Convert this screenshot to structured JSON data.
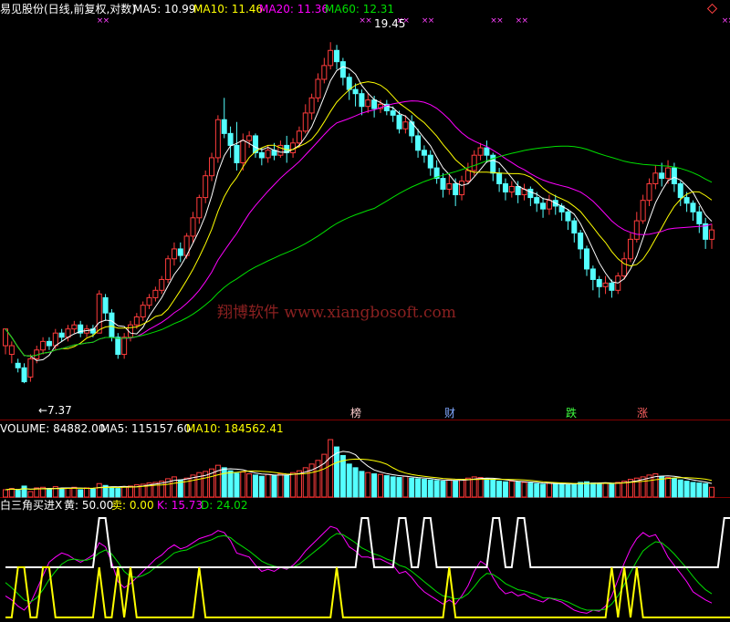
{
  "colors": {
    "background": "#000000",
    "up": "#ff3c3c",
    "down": "#54ffff",
    "ma5": "#ffffff",
    "ma10": "#ffff00",
    "ma20": "#ff00ff",
    "ma60": "#00e000",
    "separator": "#800000",
    "watermark": "#8a2020"
  },
  "header": {
    "title": "易见股份(日线,前复权,对数)",
    "ma5_label": "MA5: 10.99",
    "ma10_label": "MA10: 11.46",
    "ma20_label": "MA20: 11.36",
    "ma60_label": "MA60: 12.31",
    "corner_icon": "diamond-icon"
  },
  "annotations": {
    "high_label": "19.45",
    "low_label": "←7.37",
    "markers": [
      "榜",
      "财",
      "跌",
      "涨"
    ]
  },
  "watermark": "翔博软件 www.xiangbosoft.com",
  "volume_header": {
    "label": "VOLUME: 84882.00",
    "ma5": "MA5: 115157.60",
    "ma10": "MA10: 184562.41"
  },
  "indicator_header": {
    "name": "白三角买进X",
    "huang": "黄: 50.00",
    "mai": "卖: 0.00",
    "k": "K: 15.73",
    "d": "D: 24.02"
  },
  "chart_data": {
    "type": "candlestick",
    "price_range": [
      7.0,
      20.5
    ],
    "price_scale": "log",
    "high": 19.45,
    "low": 7.37,
    "candles": [
      [
        8.2,
        8.6,
        8.4,
        8.0
      ],
      [
        8.0,
        8.2,
        8.3,
        7.8
      ],
      [
        7.8,
        7.7,
        7.9,
        7.6
      ],
      [
        7.7,
        7.4,
        7.8,
        7.37
      ],
      [
        7.5,
        7.9,
        8.0,
        7.4
      ],
      [
        7.9,
        8.1,
        8.2,
        7.8
      ],
      [
        8.1,
        8.3,
        8.4,
        8.0
      ],
      [
        8.3,
        8.2,
        8.4,
        8.1
      ],
      [
        8.2,
        8.5,
        8.6,
        8.1
      ],
      [
        8.5,
        8.4,
        8.6,
        8.3
      ],
      [
        8.4,
        8.6,
        8.7,
        8.3
      ],
      [
        8.6,
        8.7,
        8.8,
        8.5
      ],
      [
        8.7,
        8.5,
        8.8,
        8.4
      ],
      [
        8.5,
        8.6,
        8.7,
        8.4
      ],
      [
        8.6,
        8.5,
        8.7,
        8.4
      ],
      [
        8.5,
        9.5,
        9.6,
        8.5
      ],
      [
        9.4,
        9.0,
        9.5,
        8.8
      ],
      [
        9.0,
        8.4,
        9.1,
        8.3
      ],
      [
        8.4,
        8.0,
        8.5,
        7.9
      ],
      [
        8.0,
        8.4,
        8.5,
        7.9
      ],
      [
        8.4,
        8.7,
        8.8,
        8.3
      ],
      [
        8.7,
        8.9,
        9.0,
        8.6
      ],
      [
        8.9,
        9.2,
        9.3,
        8.8
      ],
      [
        9.2,
        9.4,
        9.5,
        9.1
      ],
      [
        9.4,
        9.6,
        9.7,
        9.3
      ],
      [
        9.6,
        9.9,
        10.0,
        9.5
      ],
      [
        9.9,
        10.5,
        10.6,
        9.8
      ],
      [
        10.5,
        10.8,
        11.0,
        10.3
      ],
      [
        10.8,
        10.6,
        11.0,
        10.4
      ],
      [
        10.6,
        11.2,
        11.3,
        10.5
      ],
      [
        11.2,
        11.8,
        12.0,
        11.0
      ],
      [
        11.8,
        12.5,
        12.6,
        11.6
      ],
      [
        12.5,
        13.3,
        13.5,
        12.3
      ],
      [
        13.3,
        14.0,
        14.2,
        13.1
      ],
      [
        14.0,
        15.6,
        15.8,
        13.8
      ],
      [
        15.6,
        15.0,
        16.6,
        14.8
      ],
      [
        15.0,
        14.5,
        15.3,
        14.0
      ],
      [
        14.5,
        13.8,
        15.5,
        13.5
      ],
      [
        13.8,
        14.7,
        15.0,
        13.5
      ],
      [
        14.7,
        14.9,
        15.1,
        14.4
      ],
      [
        14.9,
        14.2,
        15.0,
        14.0
      ],
      [
        14.2,
        14.0,
        14.4,
        13.7
      ],
      [
        14.0,
        14.3,
        14.5,
        13.8
      ],
      [
        14.3,
        14.1,
        14.6,
        13.9
      ],
      [
        14.1,
        14.5,
        14.7,
        14.0
      ],
      [
        14.5,
        14.2,
        14.9,
        13.8
      ],
      [
        14.2,
        14.6,
        14.8,
        14.0
      ],
      [
        14.6,
        15.1,
        15.3,
        14.4
      ],
      [
        15.1,
        15.9,
        16.3,
        15.0
      ],
      [
        15.9,
        16.6,
        16.8,
        15.6
      ],
      [
        16.6,
        17.5,
        17.8,
        16.4
      ],
      [
        17.5,
        18.2,
        18.6,
        17.3
      ],
      [
        18.2,
        19.0,
        19.45,
        18.0
      ],
      [
        19.0,
        18.4,
        19.3,
        18.0
      ],
      [
        18.4,
        17.6,
        18.6,
        17.2
      ],
      [
        17.6,
        17.0,
        17.8,
        16.5
      ],
      [
        17.0,
        16.8,
        17.3,
        16.2
      ],
      [
        16.8,
        16.2,
        17.0,
        15.8
      ],
      [
        16.2,
        16.5,
        16.8,
        15.9
      ],
      [
        16.5,
        16.1,
        16.7,
        15.7
      ],
      [
        16.1,
        16.3,
        16.5,
        15.9
      ],
      [
        16.3,
        16.0,
        16.5,
        15.8
      ],
      [
        16.0,
        15.8,
        16.2,
        15.5
      ],
      [
        15.8,
        15.2,
        16.0,
        15.0
      ],
      [
        15.2,
        15.5,
        15.8,
        15.0
      ],
      [
        15.5,
        14.9,
        15.8,
        14.6
      ],
      [
        14.9,
        14.3,
        15.2,
        14.0
      ],
      [
        14.3,
        14.1,
        14.5,
        13.8
      ],
      [
        14.1,
        13.6,
        14.3,
        13.3
      ],
      [
        13.6,
        13.2,
        13.9,
        13.0
      ],
      [
        13.2,
        12.8,
        13.4,
        12.5
      ],
      [
        12.8,
        13.0,
        13.3,
        12.6
      ],
      [
        13.0,
        12.6,
        13.2,
        12.2
      ],
      [
        12.6,
        13.1,
        13.3,
        12.4
      ],
      [
        13.1,
        13.5,
        13.8,
        13.0
      ],
      [
        13.5,
        14.1,
        14.3,
        13.3
      ],
      [
        14.1,
        14.4,
        14.6,
        13.9
      ],
      [
        14.4,
        14.1,
        14.7,
        13.8
      ],
      [
        14.1,
        13.4,
        14.2,
        13.1
      ],
      [
        13.4,
        13.0,
        13.6,
        12.7
      ],
      [
        13.0,
        12.7,
        13.2,
        12.4
      ],
      [
        12.7,
        12.9,
        13.1,
        12.5
      ],
      [
        12.9,
        12.6,
        13.1,
        12.3
      ],
      [
        12.6,
        12.8,
        13.0,
        12.4
      ],
      [
        12.8,
        12.5,
        12.9,
        12.2
      ],
      [
        12.5,
        12.3,
        12.7,
        12.0
      ],
      [
        12.3,
        12.1,
        12.5,
        11.8
      ],
      [
        12.1,
        12.4,
        12.6,
        11.9
      ],
      [
        12.4,
        12.2,
        12.6,
        11.9
      ],
      [
        12.2,
        12.0,
        12.3,
        11.7
      ],
      [
        12.0,
        11.7,
        12.1,
        11.4
      ],
      [
        11.7,
        11.3,
        11.8,
        11.0
      ],
      [
        11.3,
        10.8,
        11.4,
        10.5
      ],
      [
        10.8,
        10.2,
        10.9,
        10.0
      ],
      [
        10.2,
        9.9,
        10.3,
        9.6
      ],
      [
        9.9,
        9.7,
        10.0,
        9.4
      ],
      [
        9.7,
        9.8,
        10.0,
        9.5
      ],
      [
        9.8,
        9.6,
        9.9,
        9.4
      ],
      [
        9.6,
        10.0,
        10.1,
        9.5
      ],
      [
        10.0,
        10.5,
        10.7,
        9.9
      ],
      [
        10.5,
        11.1,
        11.3,
        10.4
      ],
      [
        11.1,
        11.7,
        12.0,
        11.0
      ],
      [
        11.7,
        12.4,
        12.6,
        11.6
      ],
      [
        12.4,
        13.0,
        13.2,
        12.2
      ],
      [
        13.0,
        13.4,
        13.7,
        12.8
      ],
      [
        13.4,
        13.2,
        13.8,
        12.9
      ],
      [
        13.2,
        13.6,
        13.9,
        13.0
      ],
      [
        13.6,
        13.0,
        13.8,
        12.7
      ],
      [
        13.0,
        12.5,
        13.1,
        12.2
      ],
      [
        12.5,
        12.3,
        12.7,
        12.0
      ],
      [
        12.3,
        12.0,
        12.4,
        11.7
      ],
      [
        12.0,
        11.6,
        12.2,
        11.3
      ],
      [
        11.6,
        11.1,
        11.8,
        10.8
      ],
      [
        11.1,
        11.4,
        11.6,
        10.8
      ]
    ],
    "volume_range": [
      0,
      1000000
    ],
    "volume": [
      120000,
      140000,
      110000,
      180000,
      90000,
      150000,
      160000,
      130000,
      170000,
      140000,
      150000,
      160000,
      120000,
      150000,
      130000,
      220000,
      190000,
      160000,
      140000,
      170000,
      180000,
      200000,
      210000,
      230000,
      240000,
      260000,
      300000,
      330000,
      280000,
      310000,
      360000,
      400000,
      420000,
      460000,
      520000,
      480000,
      430000,
      390000,
      410000,
      380000,
      360000,
      340000,
      370000,
      350000,
      380000,
      360000,
      400000,
      430000,
      480000,
      540000,
      600000,
      700000,
      940000,
      820000,
      680000,
      540000,
      480000,
      420000,
      400000,
      380000,
      370000,
      350000,
      330000,
      320000,
      340000,
      310000,
      300000,
      290000,
      280000,
      270000,
      260000,
      280000,
      270000,
      290000,
      310000,
      330000,
      320000,
      300000,
      280000,
      260000,
      250000,
      260000,
      250000,
      240000,
      230000,
      220000,
      210000,
      230000,
      220000,
      210000,
      200000,
      220000,
      240000,
      250000,
      230000,
      220000,
      230000,
      220000,
      240000,
      260000,
      290000,
      310000,
      330000,
      360000,
      380000,
      340000,
      320000,
      300000,
      280000,
      260000,
      240000,
      230000,
      220000,
      160000
    ],
    "indicator_range": [
      0,
      100
    ],
    "indicator": {
      "k": [
        22,
        18,
        12,
        8,
        15,
        28,
        42,
        55,
        60,
        64,
        62,
        58,
        55,
        58,
        62,
        74,
        70,
        55,
        36,
        30,
        34,
        40,
        46,
        52,
        58,
        62,
        68,
        72,
        68,
        70,
        74,
        78,
        80,
        82,
        86,
        84,
        76,
        64,
        62,
        60,
        52,
        46,
        48,
        46,
        50,
        48,
        52,
        58,
        66,
        72,
        78,
        84,
        90,
        88,
        80,
        70,
        66,
        60,
        60,
        58,
        58,
        55,
        52,
        44,
        46,
        40,
        32,
        26,
        22,
        18,
        14,
        18,
        14,
        22,
        32,
        46,
        56,
        52,
        40,
        30,
        24,
        26,
        22,
        24,
        20,
        18,
        16,
        20,
        18,
        16,
        12,
        8,
        6,
        5,
        8,
        7,
        12,
        22,
        38,
        54,
        68,
        78,
        84,
        80,
        82,
        72,
        60,
        52,
        44,
        36,
        26,
        22,
        18,
        15
      ],
      "d": [
        35,
        30,
        24,
        18,
        16,
        20,
        28,
        38,
        46,
        53,
        57,
        58,
        57,
        57,
        59,
        64,
        67,
        63,
        55,
        46,
        41,
        40,
        42,
        45,
        50,
        54,
        59,
        64,
        66,
        67,
        70,
        73,
        75,
        77,
        80,
        81,
        79,
        74,
        70,
        66,
        61,
        56,
        53,
        51,
        50,
        49,
        50,
        53,
        58,
        63,
        68,
        73,
        79,
        83,
        82,
        78,
        74,
        69,
        66,
        63,
        61,
        58,
        56,
        52,
        50,
        46,
        41,
        36,
        31,
        26,
        22,
        21,
        19,
        20,
        24,
        31,
        39,
        44,
        43,
        39,
        34,
        31,
        28,
        27,
        25,
        23,
        20,
        20,
        19,
        18,
        16,
        13,
        10,
        8,
        8,
        8,
        9,
        14,
        22,
        33,
        45,
        56,
        66,
        71,
        75,
        74,
        69,
        63,
        56,
        49,
        41,
        34,
        28,
        24
      ],
      "white": [
        0,
        0,
        0,
        0,
        0,
        0,
        0,
        0,
        0,
        0,
        0,
        0,
        0,
        0,
        0,
        1,
        1,
        0,
        0,
        0,
        0,
        0,
        0,
        0,
        0,
        0,
        0,
        0,
        0,
        0,
        0,
        0,
        0,
        0,
        0,
        0,
        0,
        0,
        0,
        0,
        0,
        0,
        0,
        0,
        0,
        0,
        0,
        0,
        0,
        0,
        0,
        0,
        0,
        0,
        0,
        0,
        0,
        1,
        1,
        0,
        0,
        0,
        0,
        1,
        1,
        0,
        0,
        1,
        1,
        0,
        0,
        0,
        0,
        0,
        0,
        0,
        0,
        0,
        1,
        1,
        0,
        0,
        1,
        1,
        0,
        0,
        0,
        0,
        0,
        0,
        0,
        0,
        0,
        0,
        0,
        0,
        0,
        0,
        0,
        0,
        0,
        0,
        0,
        0,
        0,
        0,
        0,
        0,
        0,
        0,
        0,
        0,
        0,
        0,
        0,
        1,
        1,
        1,
        0,
        0
      ],
      "yellow": [
        0,
        0,
        1,
        1,
        0,
        0,
        1,
        1,
        0,
        0,
        0,
        0,
        0,
        0,
        0,
        1,
        0,
        0,
        1,
        0,
        1,
        0,
        0,
        0,
        0,
        0,
        0,
        0,
        0,
        0,
        0,
        1,
        0,
        0,
        0,
        0,
        0,
        0,
        0,
        0,
        0,
        0,
        0,
        0,
        0,
        0,
        0,
        0,
        0,
        0,
        0,
        0,
        0,
        1,
        0,
        0,
        0,
        0,
        0,
        0,
        0,
        0,
        0,
        0,
        0,
        0,
        0,
        0,
        0,
        0,
        0,
        1,
        0,
        0,
        0,
        0,
        0,
        0,
        0,
        0,
        0,
        0,
        0,
        0,
        0,
        0,
        0,
        0,
        0,
        0,
        0,
        0,
        0,
        0,
        0,
        0,
        0,
        1,
        0,
        1,
        0,
        1,
        0,
        0,
        0,
        0,
        0,
        0,
        0,
        0,
        0,
        0,
        0,
        0,
        0,
        0,
        0,
        0,
        0,
        0
      ]
    }
  }
}
